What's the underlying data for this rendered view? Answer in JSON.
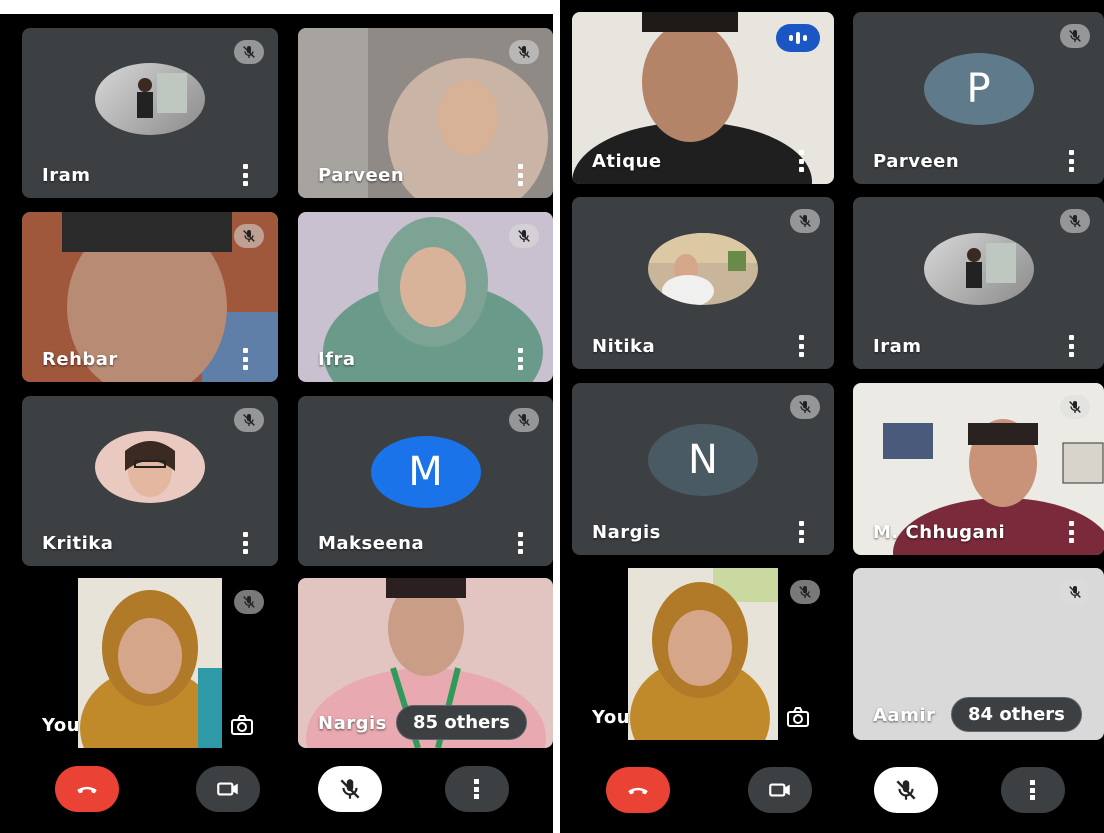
{
  "left_screen": {
    "tiles": [
      {
        "name": "Iram",
        "type": "avatar-photo"
      },
      {
        "name": "Parveen",
        "type": "video"
      },
      {
        "name": "Rehbar",
        "type": "video"
      },
      {
        "name": "Ifra",
        "type": "video"
      },
      {
        "name": "Kritika",
        "type": "avatar-photo"
      },
      {
        "name": "Makseena",
        "type": "avatar-letter",
        "letter": "M",
        "color": "#1a73e8"
      },
      {
        "name": "You",
        "type": "self-video"
      },
      {
        "name": "Nargis",
        "type": "video",
        "others": "85 others"
      }
    ]
  },
  "right_screen": {
    "tiles": [
      {
        "name": "Atique",
        "type": "video",
        "speaking": true
      },
      {
        "name": "Parveen",
        "type": "avatar-letter",
        "letter": "P",
        "color": "#5f7a8a"
      },
      {
        "name": "Nitika",
        "type": "avatar-photo"
      },
      {
        "name": "Iram",
        "type": "avatar-photo"
      },
      {
        "name": "Nargis",
        "type": "avatar-letter",
        "letter": "N",
        "color": "#4a5a63"
      },
      {
        "name": "M. Chhugani",
        "type": "video"
      },
      {
        "name": "You",
        "type": "self-video"
      },
      {
        "name": "Aamir",
        "type": "video",
        "others": "84 others"
      }
    ]
  },
  "colors": {
    "end_call": "#ea4335",
    "tile_bg": "#3c4043",
    "speaking_badge": "#1a56c4",
    "muted_button": "#ffffff"
  },
  "icons": {
    "end_call": "phone-hangup-icon",
    "camera": "video-camera-icon",
    "mic": "mic-off-icon",
    "more": "more-vert-icon",
    "tile_mute": "mic-off-icon",
    "camera_switch": "camera-switch-icon"
  }
}
